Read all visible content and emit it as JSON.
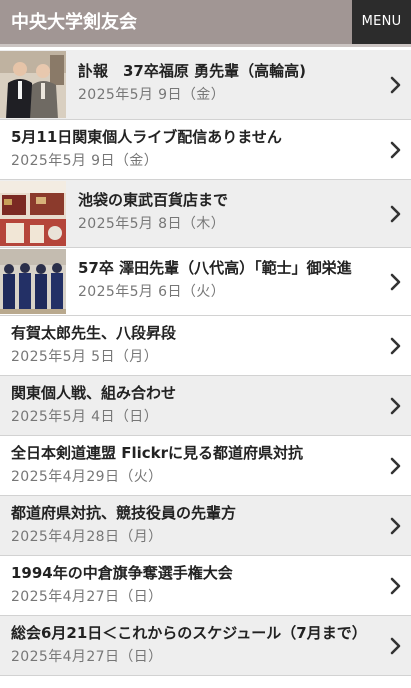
{
  "header": {
    "title": "中央大学剣友会",
    "menu_label": "MENU"
  },
  "posts": [
    {
      "title": "訃報　37卒福原 勇先輩（高輪高)",
      "date": "2025年5月 9日（金）",
      "thumbnail": "two-men-suits-photo"
    },
    {
      "title": "5月11日関東個人ライブ配信ありません",
      "date": "2025年5月 9日（金）"
    },
    {
      "title": "池袋の東武百貨店まで",
      "date": "2025年5月 8日（木）",
      "thumbnail": "department-store-display-photo"
    },
    {
      "title": "57卒 澤田先輩（八代高）「範士」御栄進",
      "date": "2025年5月 6日（火）",
      "thumbnail": "kendo-group-photo"
    },
    {
      "title": "有賀太郎先生、八段昇段",
      "date": "2025年5月 5日（月）"
    },
    {
      "title": "関東個人戦、組み合わせ",
      "date": "2025年5月 4日（日）"
    },
    {
      "title": "全日本剣道連盟 Flickrに見る都道府県対抗",
      "date": "2025年4月29日（火）"
    },
    {
      "title": "都道府県対抗、競技役員の先輩方",
      "date": "2025年4月28日（月）"
    },
    {
      "title": "1994年の中倉旗争奪選手権大会",
      "date": "2025年4月27日（日）"
    },
    {
      "title": "総会6月21日＜これからのスケジュール（7月まで）",
      "date": "2025年4月27日（日）"
    }
  ],
  "colors": {
    "header_bg": "#a19694",
    "menu_bg": "#2c2c2c",
    "row_alt_bg": "#eeeeee",
    "title_text": "#222222",
    "date_text": "#777777"
  },
  "icons": {
    "row_arrow": "chevron-right-icon"
  }
}
